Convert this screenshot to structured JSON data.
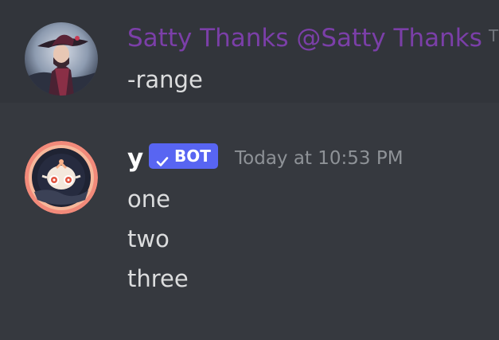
{
  "messages": [
    {
      "author": "Satty Thanks @Satty Thanks",
      "timestamp_cut": "T",
      "lines": [
        "-range"
      ],
      "avatar": "user-avatar-hat-character",
      "author_color": "#7b3fa8"
    },
    {
      "author": "y",
      "badge": "BOT",
      "badge_icon": "check-icon",
      "timestamp": "Today at 10:53 PM",
      "lines": [
        "one",
        "two",
        "three"
      ],
      "avatar": "bot-avatar",
      "accent": "#5865f2"
    }
  ]
}
